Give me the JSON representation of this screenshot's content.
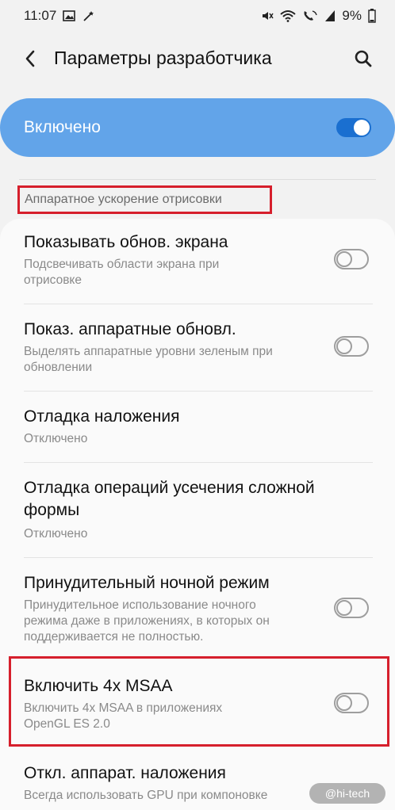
{
  "status_bar": {
    "time": "11:07",
    "battery": "9%"
  },
  "header": {
    "title": "Параметры разработчика"
  },
  "master": {
    "label": "Включено",
    "enabled": true
  },
  "section": {
    "title": "Аппаратное ускорение отрисовки"
  },
  "items": [
    {
      "title": "Показывать обнов. экрана",
      "subtitle": [
        "Подсвечивать области экрана при",
        "отрисовке"
      ],
      "toggle": "off"
    },
    {
      "title": "Показ. аппаратные обновл.",
      "subtitle": [
        "Выделять аппаратные уровни зеленым при",
        "обновлении"
      ],
      "toggle": "off"
    },
    {
      "title": "Отладка наложения",
      "subtitle": [
        "Отключено"
      ],
      "toggle": "none"
    },
    {
      "title": [
        "Отладка операций усечения сложной",
        "формы"
      ],
      "subtitle": [
        "Отключено"
      ],
      "toggle": "none"
    },
    {
      "title": "Принудительный ночной режим",
      "subtitle": [
        "Принудительное использование ночного",
        "режима даже в приложениях, в которых он",
        "поддерживается не полностью."
      ],
      "toggle": "off"
    },
    {
      "title": "Включить 4x MSAA",
      "subtitle": [
        "Включить 4x MSAA в приложениях",
        "OpenGL ES 2.0"
      ],
      "toggle": "off"
    },
    {
      "title": "Откл. аппарат. наложения",
      "subtitle": [
        "Всегда использовать GPU при компоновке"
      ],
      "toggle": "none"
    }
  ],
  "watermark": "@hi-tech",
  "colors": {
    "accent": "#62a4e9",
    "switch_on": "#1a6fd0",
    "highlight": "#d61f2c"
  }
}
